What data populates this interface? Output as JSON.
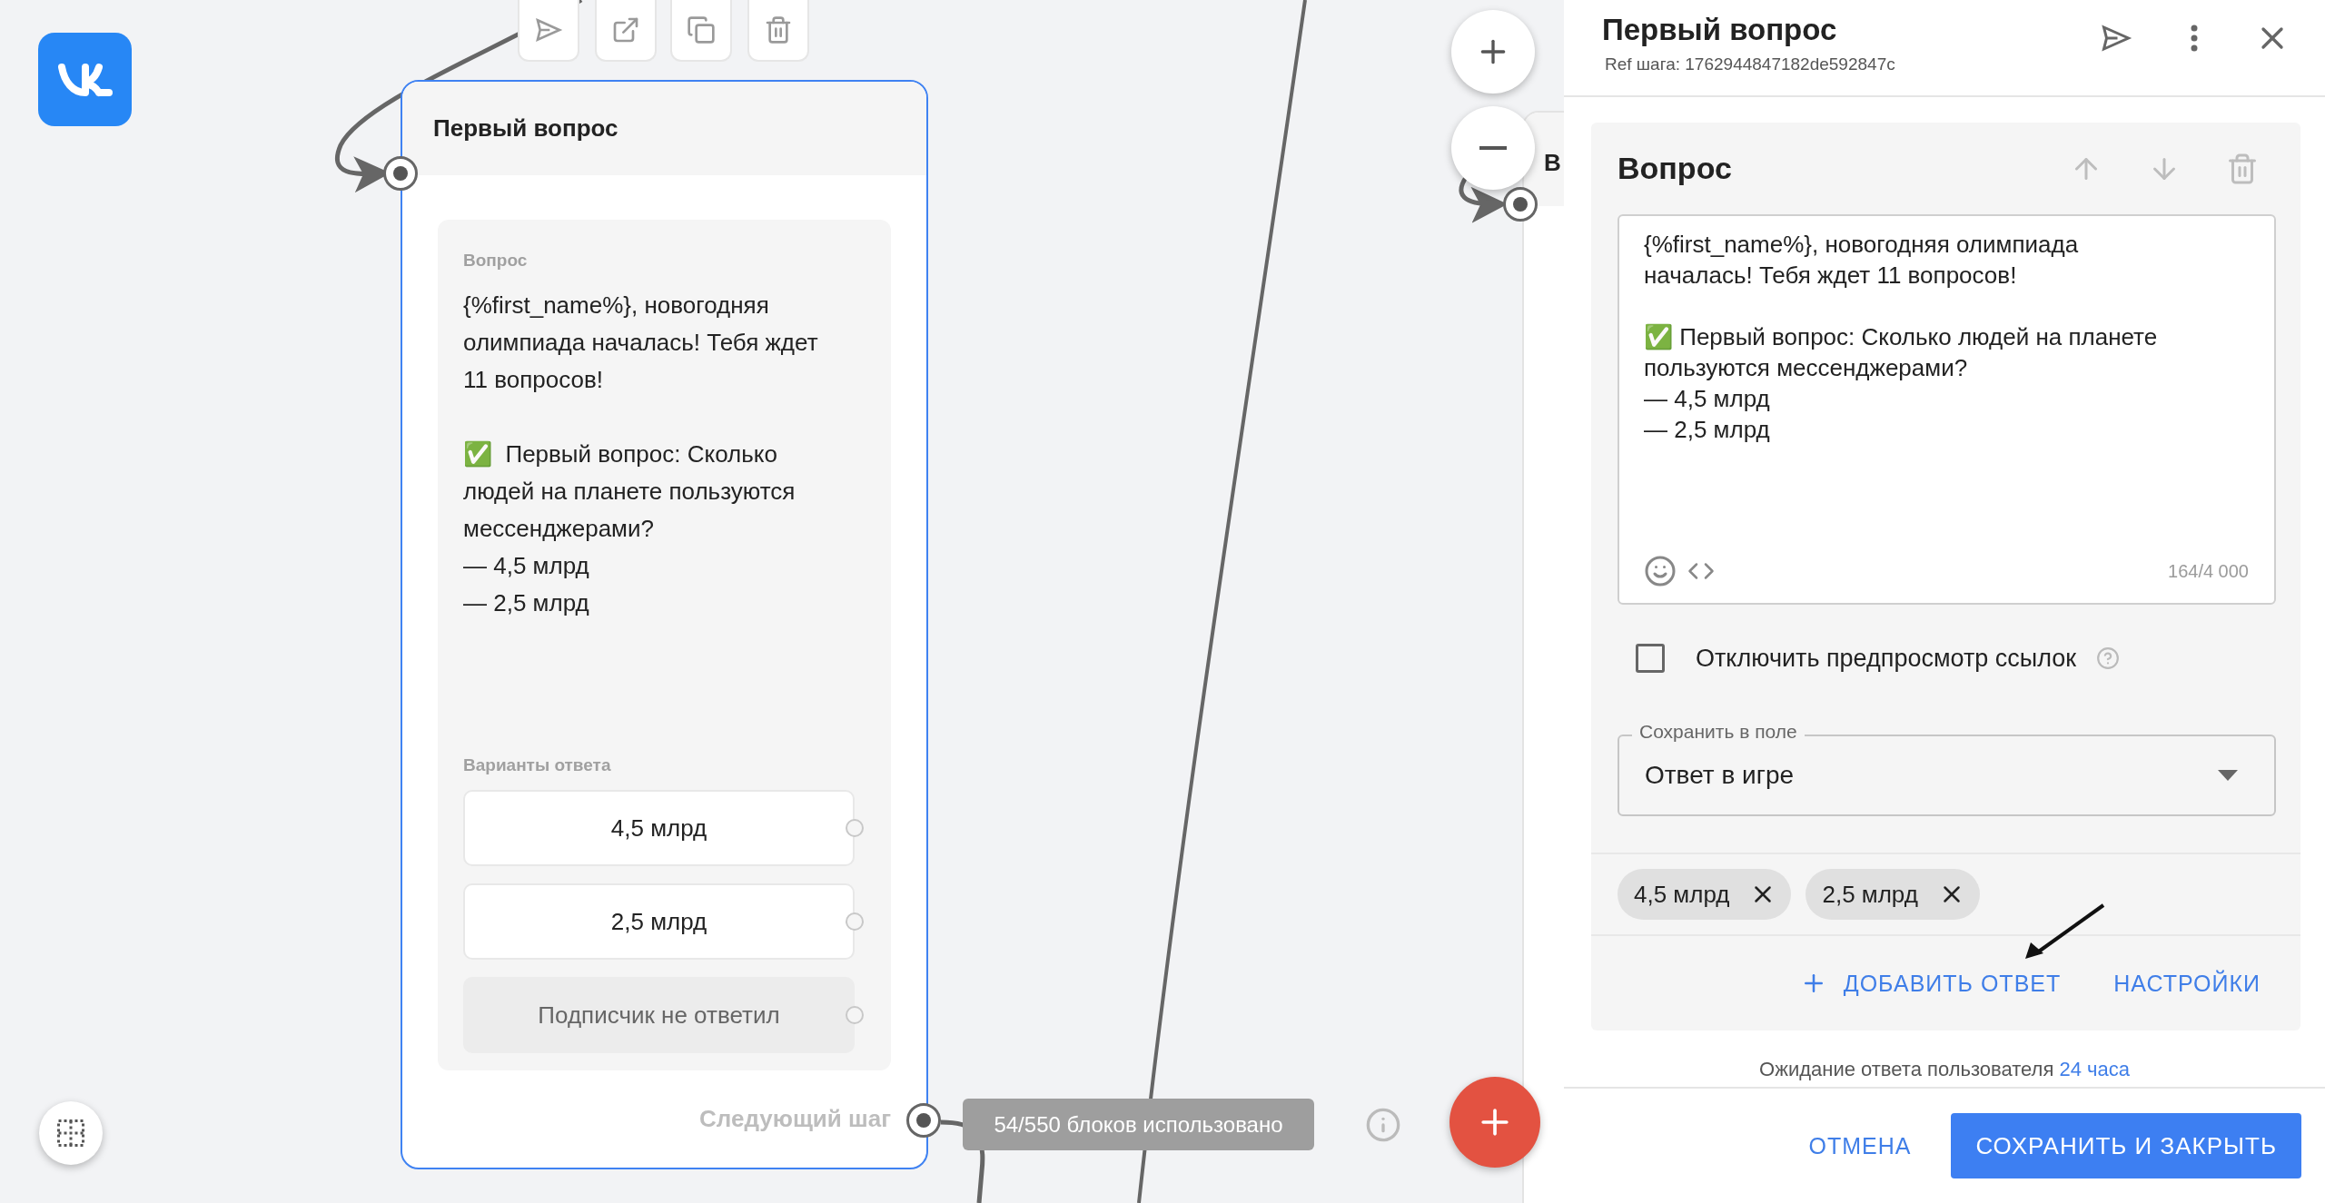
{
  "canvas": {
    "node": {
      "title": "Первый вопрос",
      "selected": true,
      "question_label": "Вопрос",
      "question_text": "{%first_name%}, новогодняя олимпиада началась! Тебя ждет 11 вопросов!\n\n✅  Первый вопрос: Сколько людей на планете пользуются мессенджерами?\n— 4,5 млрд\n— 2,5 млрд",
      "options_label": "Варианты ответа",
      "options": [
        {
          "label": "4,5 млрд",
          "kind": "answer"
        },
        {
          "label": "2,5 млрд",
          "kind": "answer"
        },
        {
          "label": "Подписчик не ответил",
          "kind": "no_reply"
        }
      ],
      "next_step_label": "Следующий шаг"
    },
    "usage_badge": "54/550 блоков использовано",
    "partial_node": {
      "title": "В"
    }
  },
  "panel": {
    "title": "Первый вопрос",
    "ref": "Ref шага: 1762944847182de592847c",
    "section": {
      "title": "Вопрос",
      "message": "{%first_name%}, новогодняя олимпиада началась! Тебя ждет 11 вопросов!\n\n✅ Первый вопрос: Сколько людей на планете пользуются мессенджерами?\n— 4,5 млрд\n— 2,5 млрд",
      "counter": "164/4 000",
      "disable_link_preview": {
        "label": "Отключить предпросмотр ссылок",
        "checked": false
      },
      "save_field": {
        "label": "Сохранить в поле",
        "value": "Ответ в игре"
      },
      "chips": [
        "4,5 млрд",
        "2,5 млрд"
      ],
      "add_answer": "ДОБАВИТЬ ОТВЕТ",
      "settings": "НАСТРОЙКИ"
    },
    "wait": {
      "text": "Ожидание ответа пользователя",
      "link": "24 часа"
    },
    "cancel": "ОТМЕНА",
    "save": "СОХРАНИТЬ И ЗАКРЫТЬ"
  }
}
